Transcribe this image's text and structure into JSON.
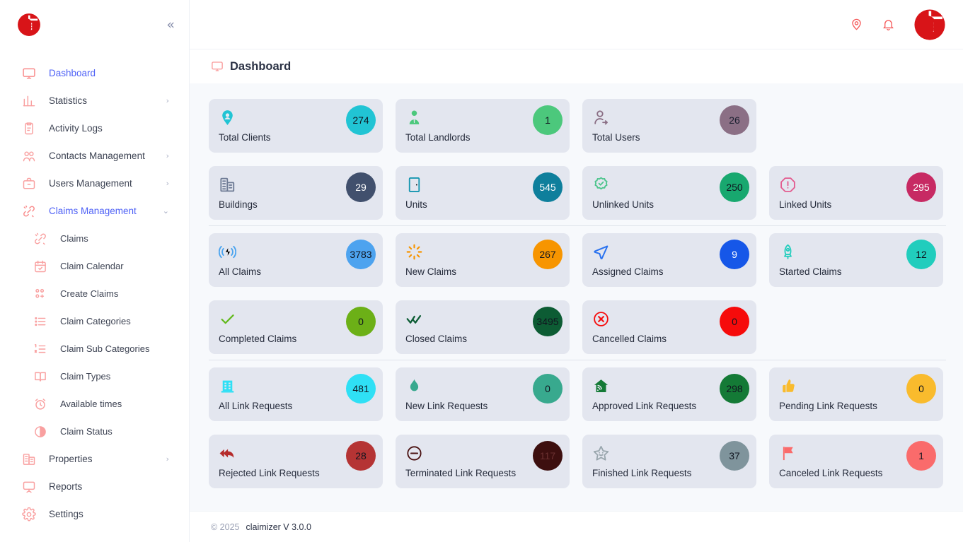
{
  "brand": {
    "logo_name": "claimizer-logo"
  },
  "sidebar": {
    "collapse_label": "«",
    "items": [
      {
        "label": "Dashboard",
        "icon": "monitor-icon",
        "active": true,
        "expandable": false,
        "sub": false
      },
      {
        "label": "Statistics",
        "icon": "bar-chart-icon",
        "active": false,
        "expandable": true,
        "sub": false,
        "caret": "›"
      },
      {
        "label": "Activity Logs",
        "icon": "clipboard-icon",
        "active": false,
        "expandable": false,
        "sub": false
      },
      {
        "label": "Contacts Management",
        "icon": "contacts-icon",
        "active": false,
        "expandable": true,
        "sub": false,
        "caret": "›"
      },
      {
        "label": "Users Management",
        "icon": "briefcase-icon",
        "active": false,
        "expandable": true,
        "sub": false,
        "caret": "›"
      },
      {
        "label": "Claims Management",
        "icon": "link-icon",
        "active": true,
        "expandable": true,
        "sub": false,
        "caret": "⌄"
      },
      {
        "label": "Claims",
        "icon": "link-icon",
        "active": false,
        "expandable": false,
        "sub": true
      },
      {
        "label": "Claim Calendar",
        "icon": "calendar-check-icon",
        "active": false,
        "expandable": false,
        "sub": true
      },
      {
        "label": "Create Claims",
        "icon": "add-items-icon",
        "active": false,
        "expandable": false,
        "sub": true
      },
      {
        "label": "Claim Categories",
        "icon": "list-icon",
        "active": false,
        "expandable": false,
        "sub": true
      },
      {
        "label": "Claim Sub Categories",
        "icon": "ordered-list-icon",
        "active": false,
        "expandable": false,
        "sub": true
      },
      {
        "label": "Claim Types",
        "icon": "book-icon",
        "active": false,
        "expandable": false,
        "sub": true
      },
      {
        "label": "Available times",
        "icon": "alarm-clock-icon",
        "active": false,
        "expandable": false,
        "sub": true
      },
      {
        "label": "Claim Status",
        "icon": "half-circle-icon",
        "active": false,
        "expandable": false,
        "sub": true
      },
      {
        "label": "Properties",
        "icon": "building-icon",
        "active": false,
        "expandable": true,
        "sub": false,
        "caret": "›"
      },
      {
        "label": "Reports",
        "icon": "presentation-icon",
        "active": false,
        "expandable": false,
        "sub": false
      },
      {
        "label": "Settings",
        "icon": "gear-icon",
        "active": false,
        "expandable": false,
        "sub": false
      }
    ]
  },
  "topbar": {
    "icons": [
      {
        "name": "location-pin-icon"
      },
      {
        "name": "bell-icon"
      }
    ],
    "avatar_name": "claimizer-avatar-logo"
  },
  "page": {
    "title": "Dashboard",
    "title_icon": "monitor-icon"
  },
  "groups": [
    {
      "name": "entities",
      "cards": [
        {
          "title": "Total Clients",
          "value": "274",
          "icon": "map-pin-user-icon",
          "icon_color": "#21c4d4",
          "badge_color": "#21c4d4",
          "num_color": "#10151f"
        },
        {
          "title": "Total Landlords",
          "value": "1",
          "icon": "person-tie-icon",
          "icon_color": "#4cc87c",
          "badge_color": "#4cc87c",
          "num_color": "#10151f"
        },
        {
          "title": "Total Users",
          "value": "26",
          "icon": "user-arrow-icon",
          "icon_color": "#8b6f85",
          "badge_color": "#8b6f85",
          "num_color": "#1b2030"
        },
        {
          "title": "",
          "value": "",
          "icon": "",
          "icon_color": "",
          "badge_color": "",
          "num_color": "",
          "empty": true
        },
        {
          "title": "Buildings",
          "value": "29",
          "icon": "buildings-icon",
          "icon_color": "#6d7a94",
          "badge_color": "#41506d",
          "num_color": "#ffffff"
        },
        {
          "title": "Units",
          "value": "545",
          "icon": "door-icon",
          "icon_color": "#1596b0",
          "badge_color": "#0e7f9c",
          "num_color": "#ffffff"
        },
        {
          "title": "Unlinked Units",
          "value": "250",
          "icon": "badge-check-icon",
          "icon_color": "#4cc48c",
          "badge_color": "#18a86f",
          "num_color": "#10151f"
        },
        {
          "title": "Linked Units",
          "value": "295",
          "icon": "octagon-alert-icon",
          "icon_color": "#e35c8f",
          "badge_color": "#c72a63",
          "num_color": "#ffffff"
        }
      ]
    },
    {
      "name": "claims",
      "cards": [
        {
          "title": "All Claims",
          "value": "3783",
          "icon": "broadcast-icon",
          "icon_color": "#49a3ef",
          "badge_color": "#4da3ef",
          "num_color": "#10151f"
        },
        {
          "title": "New Claims",
          "value": "267",
          "icon": "sparkle-icon",
          "icon_color": "#f79500",
          "badge_color": "#f79500",
          "num_color": "#10151f"
        },
        {
          "title": "Assigned Claims",
          "value": "9",
          "icon": "send-icon",
          "icon_color": "#2a72ef",
          "badge_color": "#1657e8",
          "num_color": "#ffffff"
        },
        {
          "title": "Started Claims",
          "value": "12",
          "icon": "rocket-icon",
          "icon_color": "#22cdbd",
          "badge_color": "#21cdbd",
          "num_color": "#10151f"
        },
        {
          "title": "Completed Claims",
          "value": "0",
          "icon": "check-icon",
          "icon_color": "#62b91c",
          "badge_color": "#6cb017",
          "num_color": "#10151f"
        },
        {
          "title": "Closed Claims",
          "value": "3495",
          "icon": "double-check-icon",
          "icon_color": "#0c5c34",
          "badge_color": "#0d5c34",
          "num_color": "#10151f"
        },
        {
          "title": "Cancelled Claims",
          "value": "0",
          "icon": "circle-x-icon",
          "icon_color": "#f60b0b",
          "badge_color": "#f60b0b",
          "num_color": "#10151f"
        },
        {
          "title": "",
          "value": "",
          "icon": "",
          "icon_color": "",
          "badge_color": "",
          "num_color": "",
          "empty": true
        }
      ]
    },
    {
      "name": "link-requests",
      "cards": [
        {
          "title": "All Link Requests",
          "value": "481",
          "icon": "office-building-icon",
          "icon_color": "#2fe0f5",
          "badge_color": "#2fe0f5",
          "num_color": "#10151f"
        },
        {
          "title": "New Link Requests",
          "value": "0",
          "icon": "droplet-icon",
          "icon_color": "#38a98e",
          "badge_color": "#38a98e",
          "num_color": "#10151f"
        },
        {
          "title": "Approved Link Requests",
          "value": "298",
          "icon": "house-signal-icon",
          "icon_color": "#147a36",
          "badge_color": "#147a36",
          "num_color": "#10151f"
        },
        {
          "title": "Pending Link Requests",
          "value": "0",
          "icon": "thumbs-up-icon",
          "icon_color": "#f9bb2d",
          "badge_color": "#f9bb2d",
          "num_color": "#10151f"
        },
        {
          "title": "Rejected Link Requests",
          "value": "28",
          "icon": "reply-all-icon",
          "icon_color": "#b52b2b",
          "badge_color": "#b53434",
          "num_color": "#10151f"
        },
        {
          "title": "Terminated Link Requests",
          "value": "117",
          "icon": "minus-circle-icon",
          "icon_color": "#4a1111",
          "badge_color": "#3d0f0f",
          "num_color": "#6b3030"
        },
        {
          "title": "Finished Link Requests",
          "value": "37",
          "icon": "star-smile-icon",
          "icon_color": "#99a6ad",
          "badge_color": "#7f949c",
          "num_color": "#10151f"
        },
        {
          "title": "Canceled Link Requests",
          "value": "1",
          "icon": "flag-icon",
          "icon_color": "#fa6b6b",
          "badge_color": "#fa6b6b",
          "num_color": "#10151f"
        }
      ]
    }
  ],
  "footer": {
    "copyright": "© 2025",
    "app": "claimizer V 3.0.0"
  }
}
